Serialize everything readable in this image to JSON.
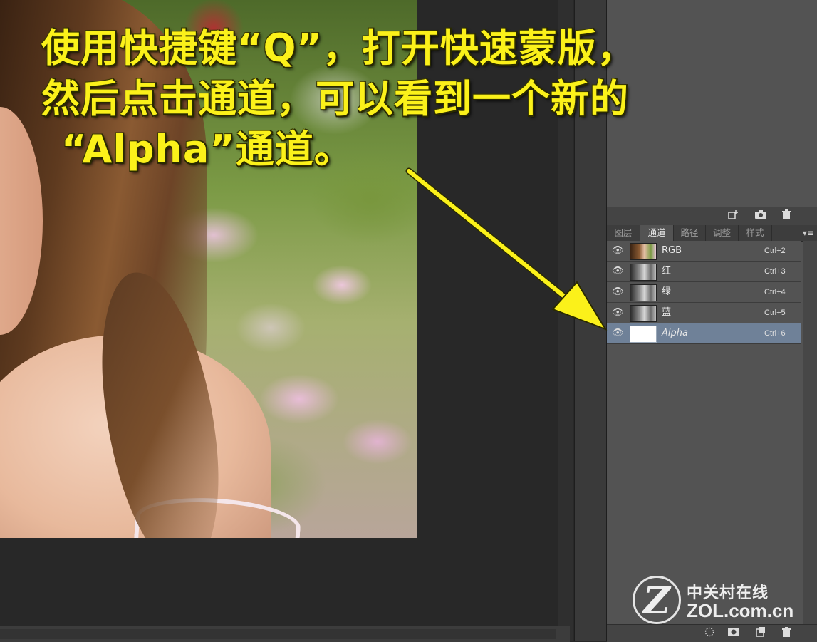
{
  "caption": {
    "line1": "使用快捷键“Q”，打开快速蒙版，",
    "line2": "然后点击通道，可以看到一个新的",
    "line3": "“Alpha”通道。"
  },
  "panel": {
    "tabs": [
      {
        "label": "图层",
        "active": false
      },
      {
        "label": "通道",
        "active": true
      },
      {
        "label": "路径",
        "active": false
      },
      {
        "label": "调整",
        "active": false
      },
      {
        "label": "样式",
        "active": false
      }
    ],
    "menu_icon": "panel-menu-icon",
    "channels": [
      {
        "name": "RGB",
        "shortcut": "Ctrl+2",
        "selected": false
      },
      {
        "name": "红",
        "shortcut": "Ctrl+3",
        "selected": false
      },
      {
        "name": "绿",
        "shortcut": "Ctrl+4",
        "selected": false
      },
      {
        "name": "蓝",
        "shortcut": "Ctrl+5",
        "selected": false
      },
      {
        "name": "Alpha",
        "shortcut": "Ctrl+6",
        "selected": true
      }
    ],
    "toolbar_icons": [
      "new-layer-icon",
      "camera-icon",
      "trash-icon"
    ],
    "bottom_icons": [
      "load-selection-icon",
      "save-selection-icon",
      "new-channel-icon",
      "trash-icon"
    ]
  },
  "watermark": {
    "logo_letter": "Z",
    "brand_cn": "中关村在线",
    "brand_en": "ZOL.com.cn"
  },
  "colors": {
    "caption": "#fbf11a",
    "selected_row": "#6f8198",
    "panel_bg": "#535353"
  }
}
